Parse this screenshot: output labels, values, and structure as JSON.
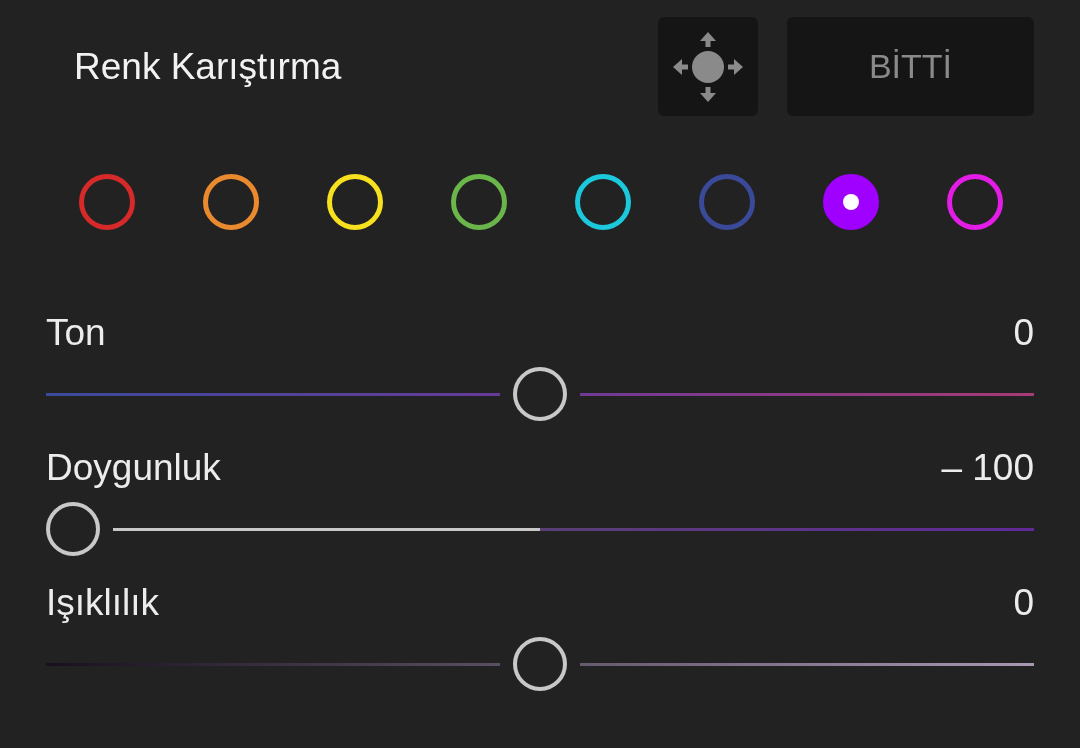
{
  "panel": {
    "title": "Renk Karıştırma",
    "done_button": "BİTTİ"
  },
  "swatches": [
    {
      "color": "#d62a2a",
      "selected": false
    },
    {
      "color": "#ea8a2e",
      "selected": false
    },
    {
      "color": "#f7e01d",
      "selected": false
    },
    {
      "color": "#6bb64a",
      "selected": false
    },
    {
      "color": "#1bc8dc",
      "selected": false
    },
    {
      "color": "#3a4a98",
      "selected": false
    },
    {
      "color": "#9f00ff",
      "selected": true
    },
    {
      "color": "#e31de6",
      "selected": false
    }
  ],
  "sliders": [
    {
      "kind": "hue",
      "label": "Ton",
      "reading": "0",
      "level": 0.5
    },
    {
      "kind": "saturation",
      "label": "Doygunluk",
      "reading": "– 100",
      "level": 0
    },
    {
      "kind": "luminance",
      "label": "Işıklılık",
      "reading": "0",
      "level": 0.5
    }
  ]
}
